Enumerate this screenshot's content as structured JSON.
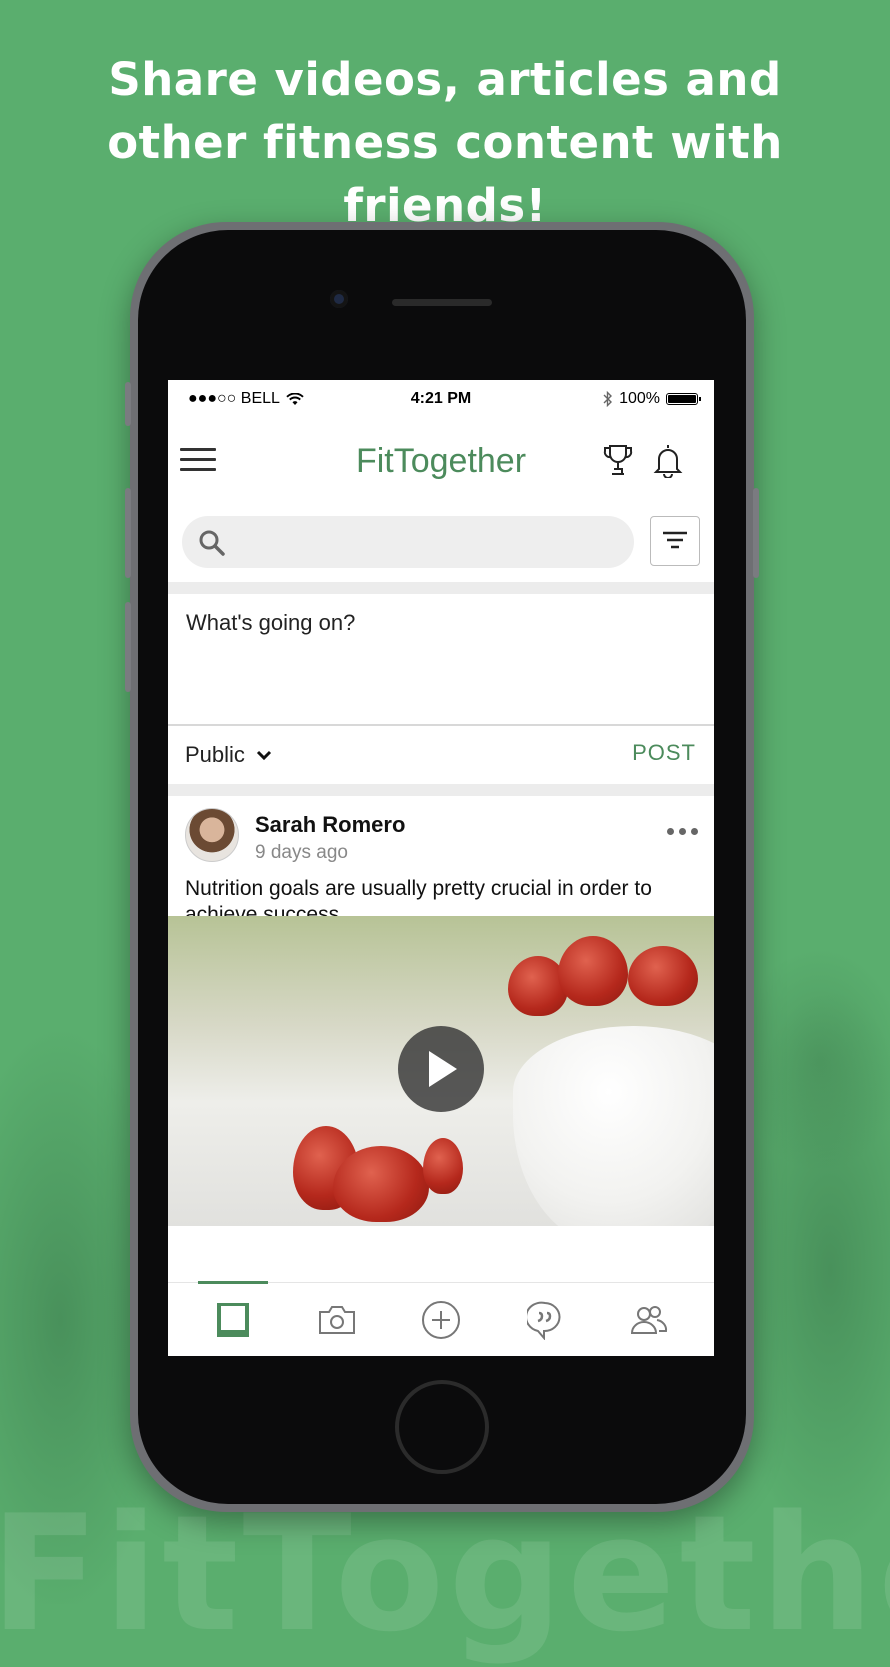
{
  "promo": {
    "headline_line1": "Share videos, articles and",
    "headline_line2": "other fitness content with friends!",
    "watermark": "FitTogether"
  },
  "status_bar": {
    "carrier": "●●●○○ BELL",
    "time": "4:21 PM",
    "battery": "100%"
  },
  "navbar": {
    "title": "FitTogether",
    "icons": [
      "menu-icon",
      "trophy-icon",
      "bell-icon"
    ]
  },
  "search": {
    "placeholder": "",
    "icons": [
      "search-icon",
      "filter-icon"
    ]
  },
  "composer": {
    "placeholder": "What's going on?",
    "audience": "Public",
    "post_label": "POST"
  },
  "post": {
    "author": "Sarah Romero",
    "time_ago": "9 days ago",
    "text": "Nutrition goals are usually pretty crucial in order to achieve success.",
    "media_type": "video"
  },
  "tabbar": {
    "tabs": [
      "feed-icon",
      "camera-icon",
      "add-icon",
      "chat-icon",
      "friends-icon"
    ],
    "active": "feed-icon"
  },
  "colors": {
    "brand_green": "#4c8b5c",
    "background_green": "#5aae6e"
  }
}
